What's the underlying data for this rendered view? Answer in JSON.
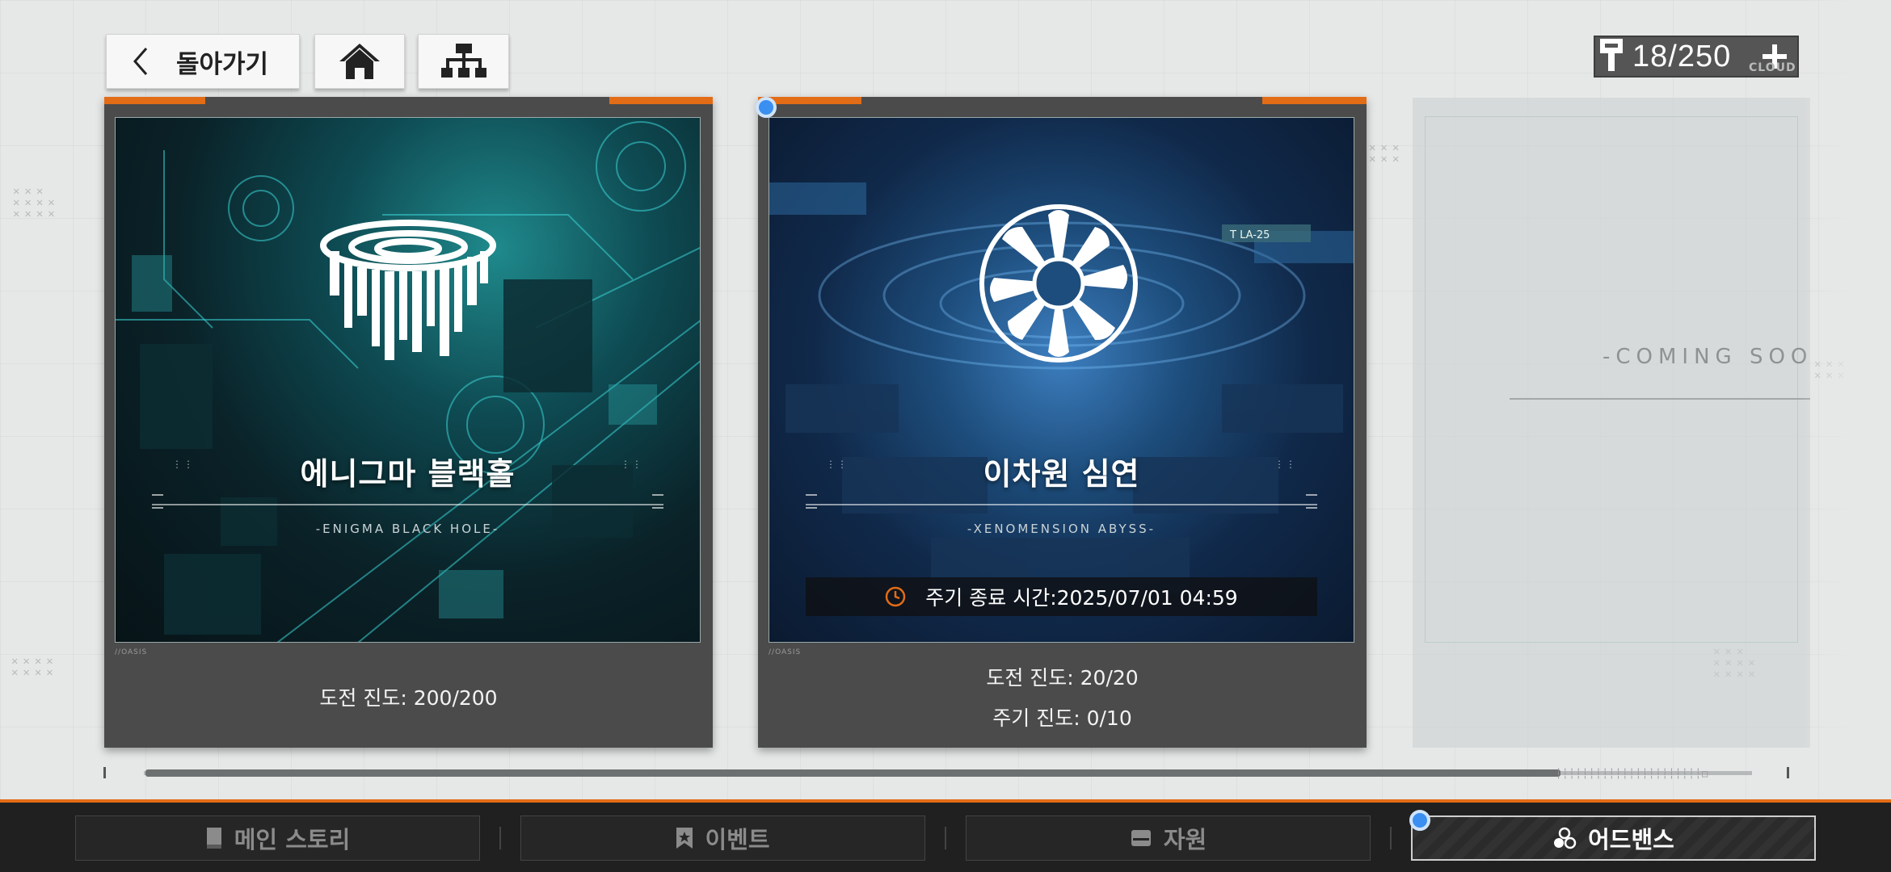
{
  "header": {
    "back_label": "돌아가기",
    "currency_count": "18/250",
    "watermark": "CLOUD"
  },
  "cards": [
    {
      "title": "에니그마 블랙홀",
      "subtitle": "-ENIGMA BLACK HOLE-",
      "tag": "//OASIS",
      "progress": "도전 진도: 200/200"
    },
    {
      "title": "이차원 심연",
      "subtitle": "-XENOMENSION ABYSS-",
      "tag": "//OASIS",
      "cycle_end": "주기 종료 시간:2025/07/01 04:59",
      "progress": "도전 진도: 20/20",
      "cycle_progress": "주기 진도: 0/10"
    }
  ],
  "coming_soon": "-COMING SOO",
  "art_sign": "T LA-25",
  "scroll_fraction": 0.88,
  "nav": {
    "items": [
      {
        "label": "메인 스토리",
        "icon": "book-icon"
      },
      {
        "label": "이벤트",
        "icon": "bookmark-star-icon"
      },
      {
        "label": "자원",
        "icon": "tray-icon"
      },
      {
        "label": "어드밴스",
        "icon": "three-circles-icon"
      }
    ],
    "active_index": 3
  },
  "colors": {
    "accent": "#e36c16",
    "indicator": "#3a8ff0",
    "card_bg": "#4b4b4b"
  }
}
